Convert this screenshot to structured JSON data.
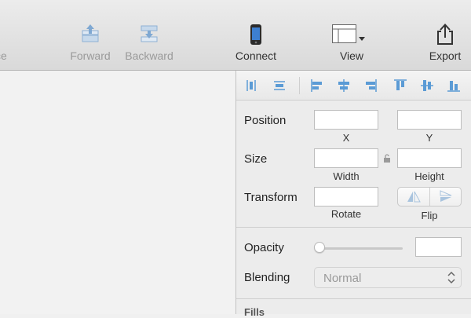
{
  "toolbar": {
    "cut_label": "ce",
    "forward_label": "Forward",
    "backward_label": "Backward",
    "connect_label": "Connect",
    "view_label": "View",
    "export_label": "Export"
  },
  "inspector": {
    "position": {
      "label": "Position",
      "x_label": "X",
      "y_label": "Y",
      "x_value": "",
      "y_value": ""
    },
    "size": {
      "label": "Size",
      "width_label": "Width",
      "height_label": "Height",
      "width_value": "",
      "height_value": ""
    },
    "transform": {
      "label": "Transform",
      "rotate_label": "Rotate",
      "rotate_value": "",
      "flip_label": "Flip"
    },
    "opacity": {
      "label": "Opacity",
      "value": "",
      "slider_level": 0
    },
    "blending": {
      "label": "Blending",
      "value": "Normal"
    },
    "fills": {
      "label": "Fills"
    }
  },
  "colors": {
    "accent_icon": "#5b9bd5",
    "disabled_icon": "#a9c4de"
  }
}
